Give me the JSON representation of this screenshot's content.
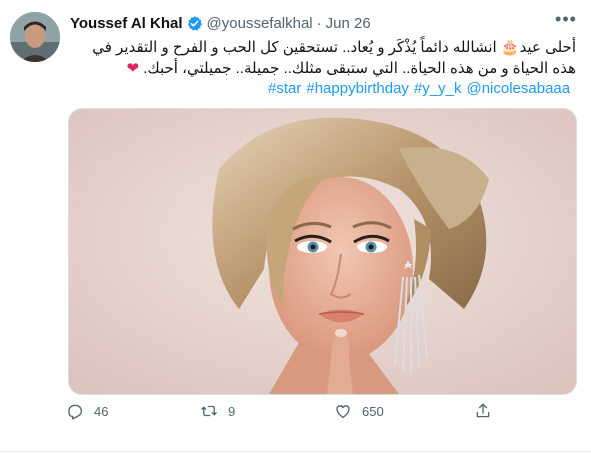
{
  "tweet": {
    "author_name": "Youssef Al Khal",
    "handle": "@youssefalkhal",
    "separator": "·",
    "date": "Jun 26",
    "more_label": "•••",
    "text_line1": "أحلى عيد🎂 انشالله دائماً يُذْكَر و يُعاد.. تستحقين كل الحب و الفرح و التقدير في",
    "text_line2": "هذه الحياة و من هذه الحياة.. التي ستبقى مثلك.. جميلة.. جميلتي، أحبك.",
    "heart": "❤",
    "hashtags": [
      "#star",
      "#happybirthday",
      "#y_y_k",
      "@nicolesabaaa"
    ]
  },
  "actions": {
    "reply_count": "46",
    "retweet_count": "9",
    "like_count": "650"
  },
  "icons": {
    "verified": "verified-badge-icon",
    "reply": "reply-icon",
    "retweet": "retweet-icon",
    "like": "like-icon",
    "share": "share-icon"
  },
  "colors": {
    "link": "#1d9bf0",
    "secondary_text": "#536471",
    "primary_text": "#0f1419",
    "heart": "#e0245e"
  }
}
